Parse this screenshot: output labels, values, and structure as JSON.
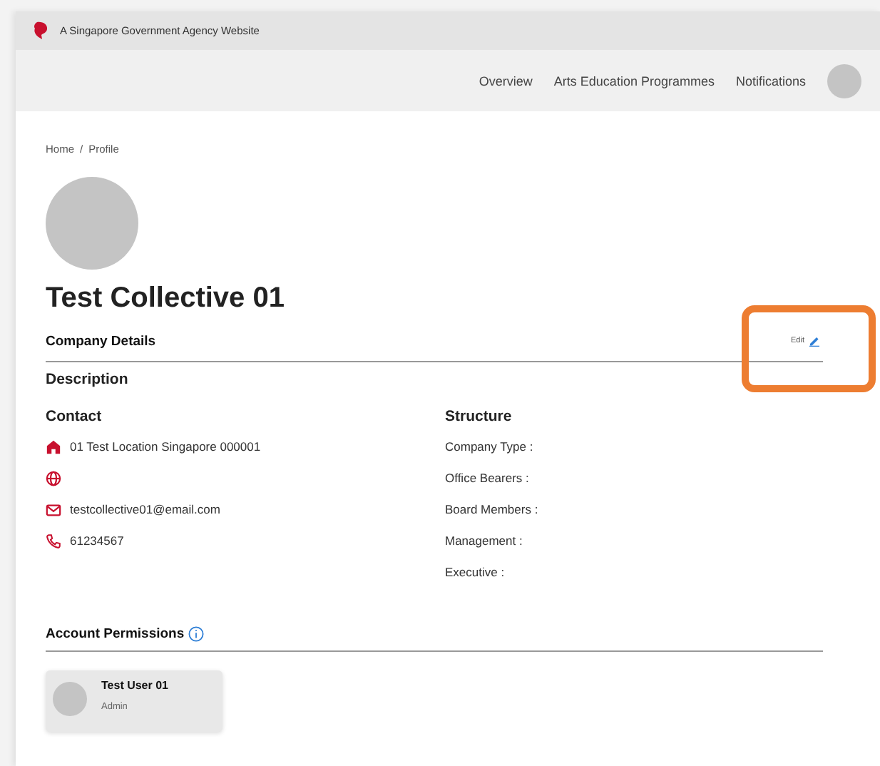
{
  "masthead": {
    "text": "A Singapore Government Agency Website"
  },
  "nav": {
    "items": [
      "Overview",
      "Arts Education Programmes",
      "Notifications"
    ]
  },
  "breadcrumb": {
    "items": [
      "Home",
      "Profile"
    ],
    "separator": "/"
  },
  "profile": {
    "name": "Test Collective 01"
  },
  "company_details": {
    "title": "Company Details",
    "edit": "Edit",
    "highlighted": true,
    "description_title": "Description",
    "contact_title": "Contact",
    "contact": [
      {
        "kind": "location",
        "text": "01 Test Location Singapore 000001"
      },
      {
        "kind": "web"
      },
      {
        "kind": "email",
        "text": "testcollective01@email.com"
      },
      {
        "kind": "phone",
        "text": "61234567"
      }
    ],
    "structure_title": "Structure",
    "structure": [
      "Company Type :",
      "Office Bearers :",
      "Board Members :",
      "Management :",
      "Executive :"
    ]
  },
  "account_permissions": {
    "title": "Account Permissions",
    "users": [
      {
        "name": "Test User 01",
        "role": "Admin"
      }
    ]
  }
}
